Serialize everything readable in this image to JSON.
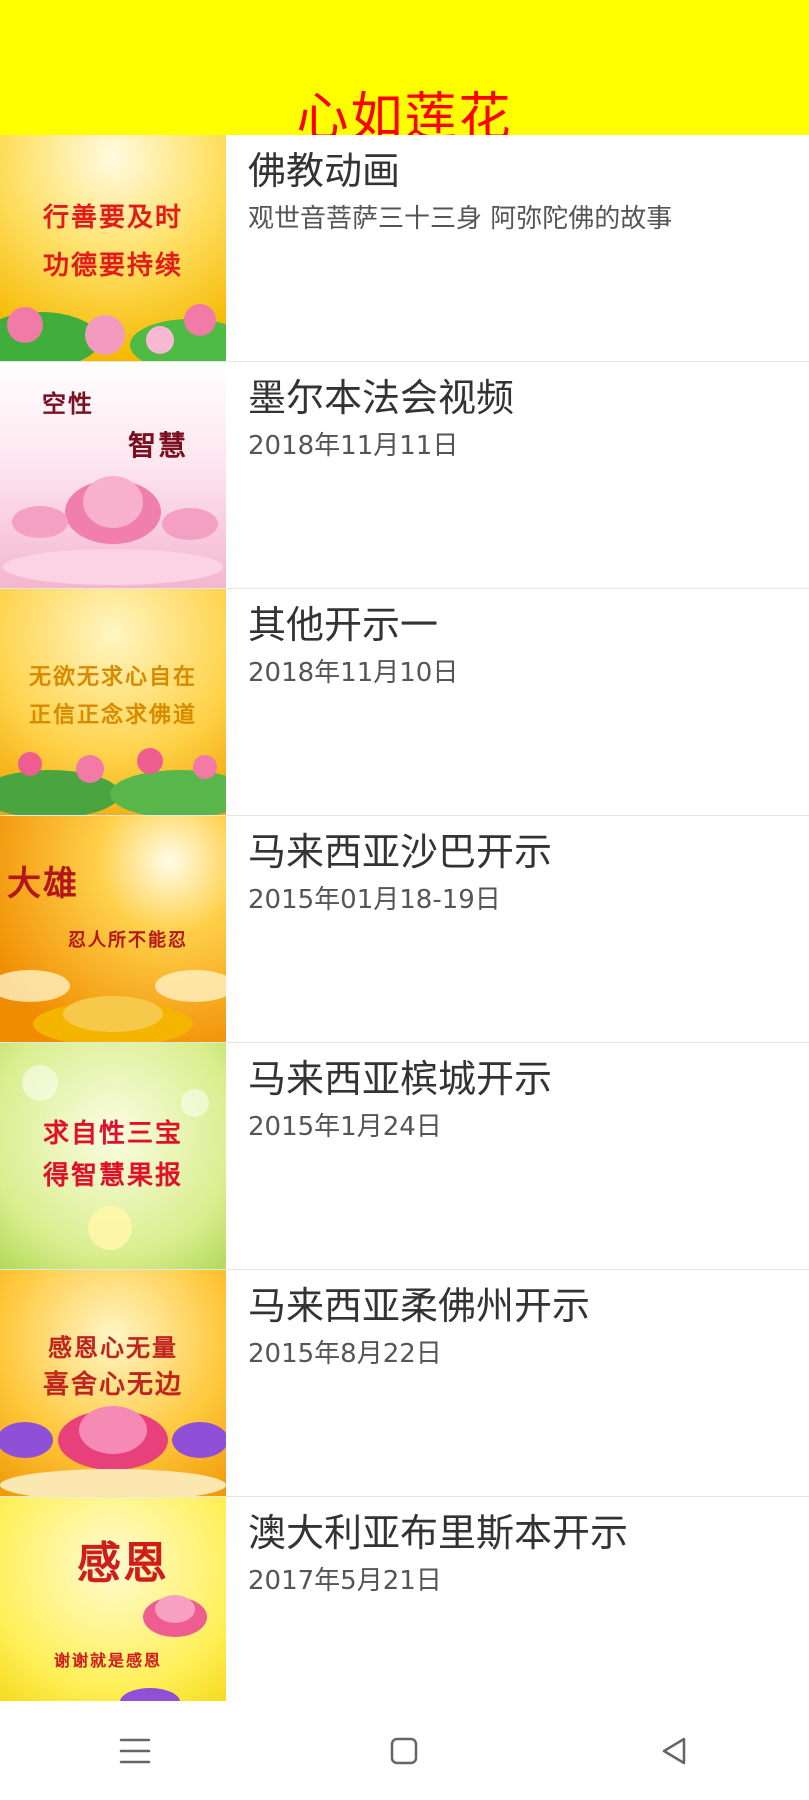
{
  "header": {
    "title": "心如莲花",
    "background": "#ffff00",
    "title_color": "#ff0000"
  },
  "items": [
    {
      "title": "佛教动画",
      "subtitle": "观世音菩萨三十三身 阿弥陀佛的故事",
      "thumb_lines": [
        "行善要及时",
        "功德要持续"
      ],
      "thumb_colors": [
        "#fff3b0",
        "#f7c400",
        "#e54d1c"
      ]
    },
    {
      "title": "墨尔本法会视频",
      "subtitle": "2018年11月11日",
      "thumb_lines": [
        "空性",
        "智慧"
      ],
      "thumb_colors": [
        "#ffffff",
        "#f7c6dd",
        "#a11d3a"
      ]
    },
    {
      "title": "其他开示一",
      "subtitle": "2018年11月10日",
      "thumb_lines": [
        "无欲无求心自在",
        "正信正念求佛道"
      ],
      "thumb_colors": [
        "#ffe27a",
        "#f2a900",
        "#e08a00"
      ]
    },
    {
      "title": "马来西亚沙巴开示",
      "subtitle": "2015年01月18-19日",
      "thumb_lines": [
        "大雄",
        "忍人所不能忍"
      ],
      "thumb_colors": [
        "#ffd36b",
        "#f39a00",
        "#b3161a"
      ]
    },
    {
      "title": "马来西亚槟城开示",
      "subtitle": "2015年1月24日",
      "thumb_lines": [
        "求自性三宝",
        "得智慧果报"
      ],
      "thumb_colors": [
        "#f6f9c8",
        "#b8dc55",
        "#e0102a"
      ]
    },
    {
      "title": "马来西亚柔佛州开示",
      "subtitle": "2015年8月22日",
      "thumb_lines": [
        "感恩心无量",
        "喜舍心无边"
      ],
      "thumb_colors": [
        "#ffe27a",
        "#f5a81c",
        "#c0241f"
      ]
    },
    {
      "title": "澳大利亚布里斯本开示",
      "subtitle": "2017年5月21日",
      "thumb_lines": [
        "感恩",
        "谢谢就是感恩"
      ],
      "thumb_colors": [
        "#fff39b",
        "#f7d300",
        "#d01c1c"
      ]
    }
  ],
  "navbar": {
    "icons": [
      "menu-icon",
      "home-icon",
      "back-icon"
    ],
    "color": "#666666"
  }
}
